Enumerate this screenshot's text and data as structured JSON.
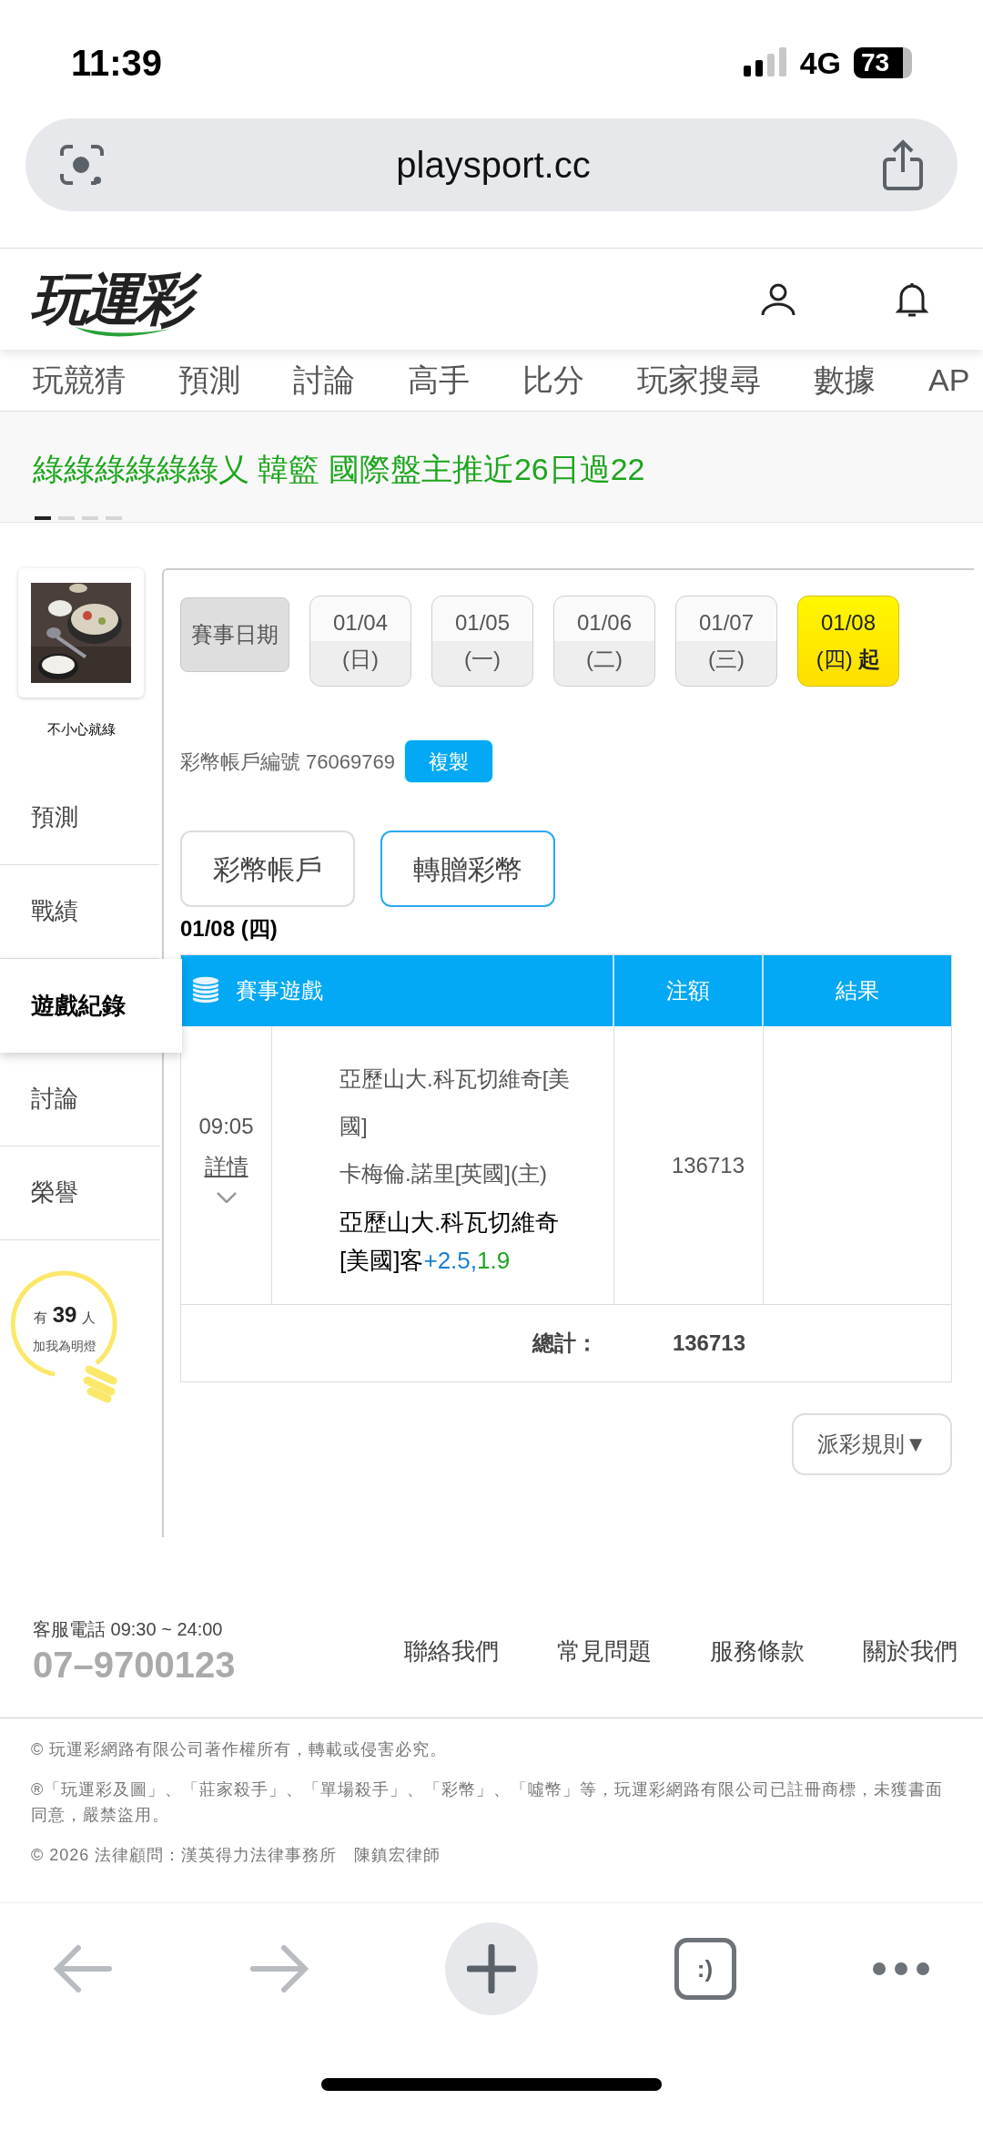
{
  "status_bar": {
    "time": "11:39",
    "network": "4G",
    "battery": "73"
  },
  "browser": {
    "url": "playsport.cc",
    "tabs_label": ":)"
  },
  "header": {
    "logo": "玩運彩"
  },
  "nav": [
    "玩競猜",
    "預測",
    "討論",
    "高手",
    "比分",
    "玩家搜尋",
    "數據",
    "AP"
  ],
  "banner": {
    "text": "綠綠綠綠綠綠乂 韓籃 國際盤主推近26日過22",
    "pages": [
      {
        "selected": true
      },
      {
        "selected": false
      },
      {
        "selected": false
      },
      {
        "selected": false
      }
    ]
  },
  "sidebar": {
    "user_name": "不小心就綠",
    "items": [
      {
        "label": "預測",
        "selected": false
      },
      {
        "label": "戰績",
        "selected": false
      },
      {
        "label": "遊戲紀錄",
        "selected": true
      },
      {
        "label": "討論",
        "selected": false
      },
      {
        "label": "榮譽",
        "selected": false
      }
    ],
    "fans": {
      "prefix": "有",
      "count": "39",
      "suffix": "人",
      "caption": "加我為明燈"
    }
  },
  "date_filter": {
    "label": "賽事日期",
    "dates": [
      {
        "date": "01/04",
        "day": "(日)",
        "selected": false
      },
      {
        "date": "01/05",
        "day": "(一)",
        "selected": false
      },
      {
        "date": "01/06",
        "day": "(二)",
        "selected": false
      },
      {
        "date": "01/07",
        "day": "(三)",
        "selected": false
      },
      {
        "date": "01/08",
        "day": "(四)",
        "suffix": "起",
        "selected": true
      }
    ]
  },
  "account": {
    "label": "彩幣帳戶編號 76069769",
    "copy_button": "複製"
  },
  "account_tabs": [
    {
      "label": "彩幣帳戶",
      "selected": false
    },
    {
      "label": "轉贈彩幣",
      "selected": true
    }
  ],
  "date_heading": "01/08 (四)",
  "table": {
    "columns": [
      "賽事遊戲",
      "注額",
      "結果"
    ],
    "rows": [
      {
        "time": "09:05",
        "detail": "詳情",
        "away": "亞歷山大.科瓦切維奇[美國]",
        "home": "卡梅倫.諾里[英國](主)",
        "pick": "亞歷山大.科瓦切維奇[美國]客",
        "handicap": "+2.5,",
        "odds": "1.9",
        "amount": "136713"
      }
    ],
    "total_label": "總計：",
    "total": "136713"
  },
  "rules_button": "派彩規則▼",
  "footer": {
    "hotline": "客服電話 09:30 ~ 24:00",
    "phone": "07–9700123",
    "links": [
      "聯絡我們",
      "常見問題",
      "服務條款",
      "關於我們"
    ],
    "notes": [
      "© 玩運彩網路有限公司著作權所有，轉載或侵害必究。",
      "®「玩運彩及圖」、「莊家殺手」、「單場殺手」、「彩幣」、「噓幣」等，玩運彩網路有限公司已註冊商標，未獲書面同意，嚴禁盜用。",
      "© 2026 法律顧問：漢英得力法律事務所　陳鎮宏律師"
    ]
  }
}
